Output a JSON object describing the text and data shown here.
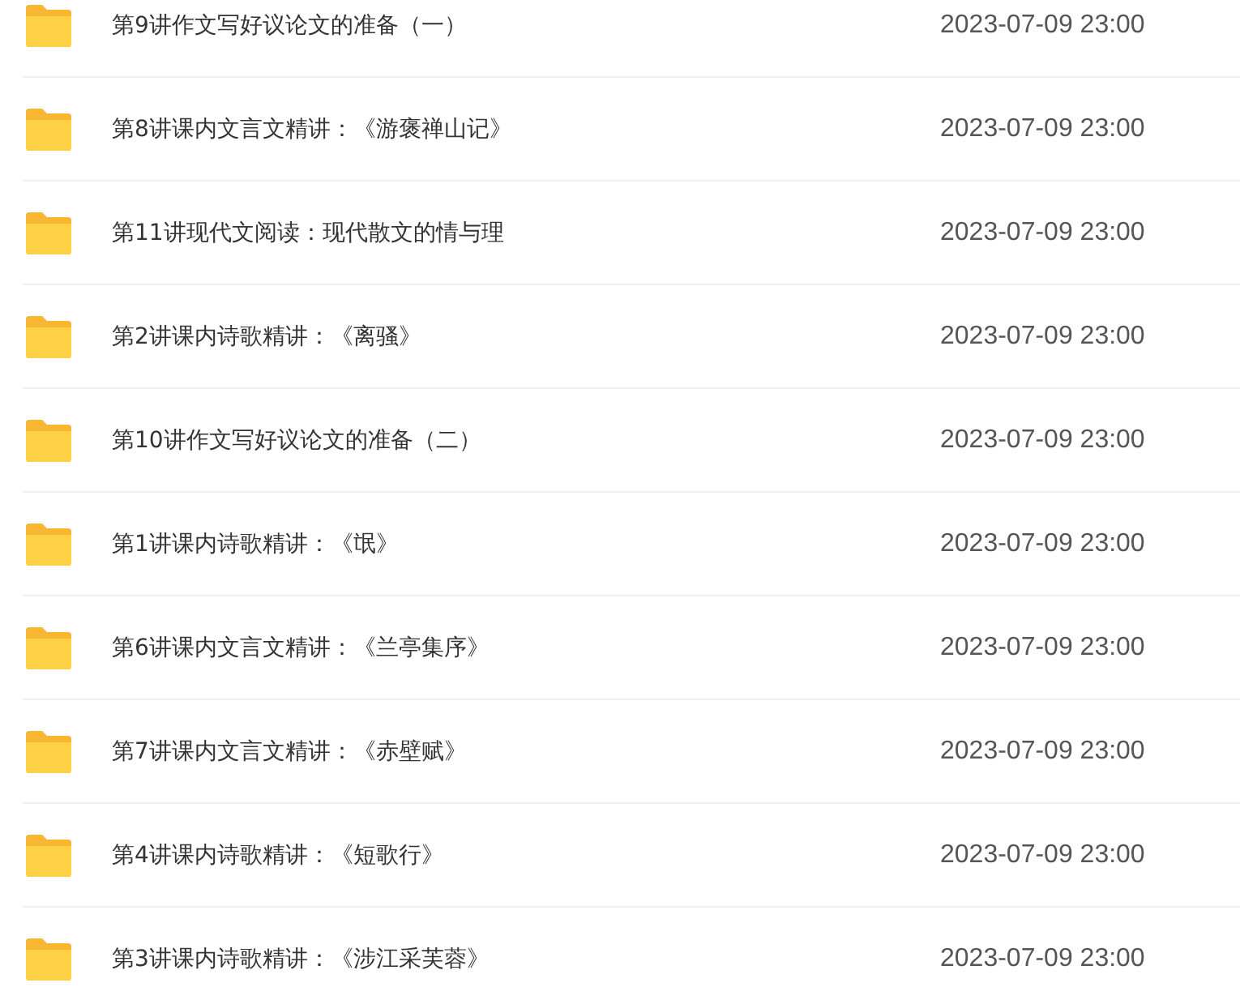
{
  "files": [
    {
      "name": "第9讲作文写好议论文的准备（一）",
      "date": "2023-07-09 23:00"
    },
    {
      "name": "第8讲课内文言文精讲：《游褒禅山记》",
      "date": "2023-07-09 23:00"
    },
    {
      "name": "第11讲现代文阅读：现代散文的情与理",
      "date": "2023-07-09 23:00"
    },
    {
      "name": "第2讲课内诗歌精讲：《离骚》",
      "date": "2023-07-09 23:00"
    },
    {
      "name": "第10讲作文写好议论文的准备（二）",
      "date": "2023-07-09 23:00"
    },
    {
      "name": "第1讲课内诗歌精讲：《氓》",
      "date": "2023-07-09 23:00"
    },
    {
      "name": "第6讲课内文言文精讲：《兰亭集序》",
      "date": "2023-07-09 23:00"
    },
    {
      "name": "第7讲课内文言文精讲：《赤壁赋》",
      "date": "2023-07-09 23:00"
    },
    {
      "name": "第4讲课内诗歌精讲：《短歌行》",
      "date": "2023-07-09 23:00"
    },
    {
      "name": "第3讲课内诗歌精讲：《涉江采芙蓉》",
      "date": "2023-07-09 23:00"
    }
  ]
}
